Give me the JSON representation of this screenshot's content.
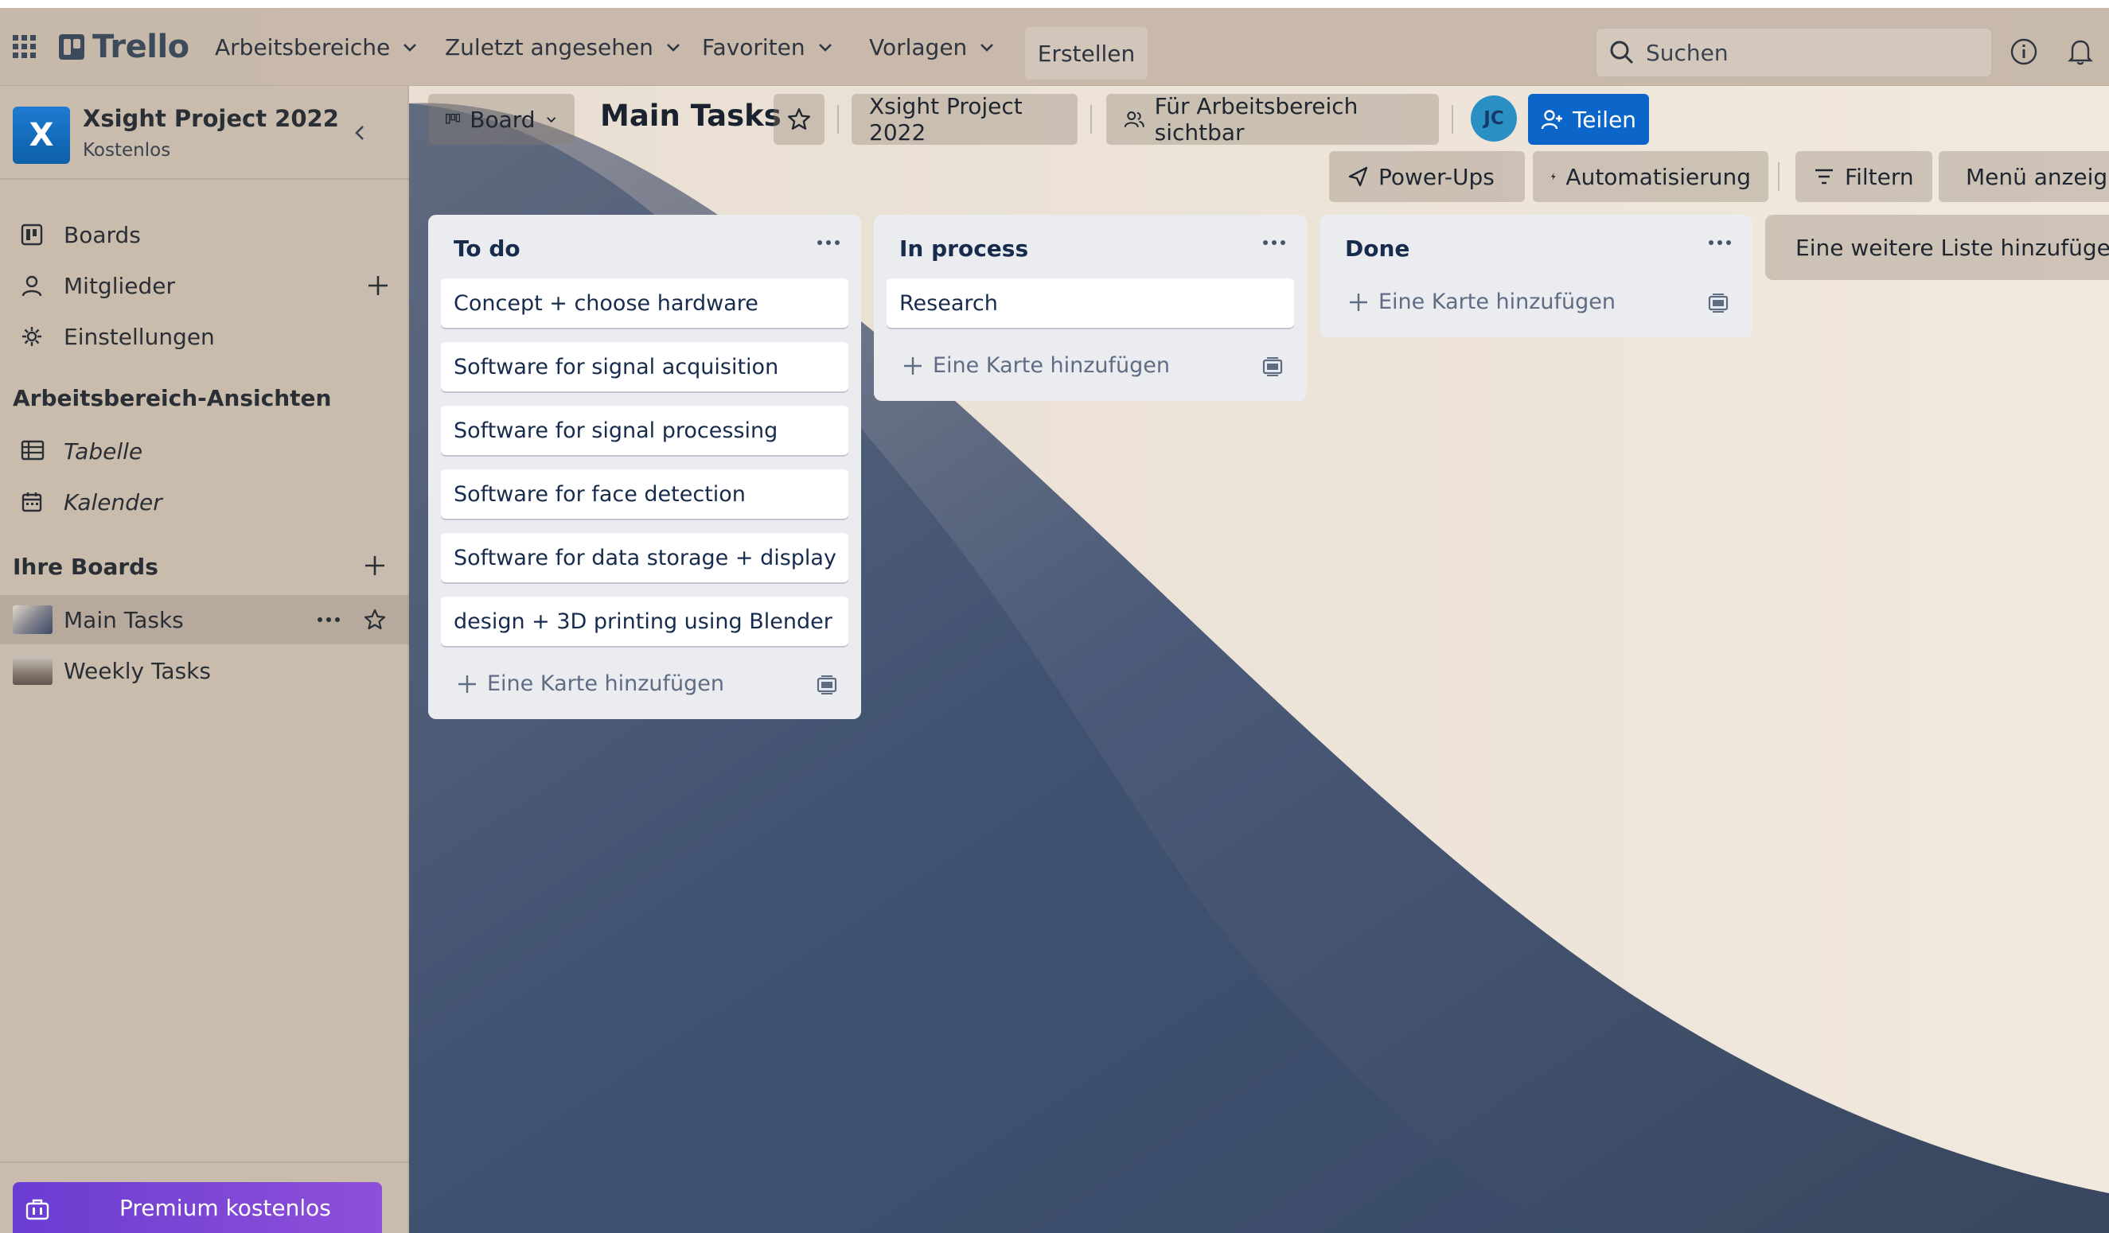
{
  "header": {
    "logo": "Trello",
    "nav": [
      "Arbeitsbereiche",
      "Zuletzt angesehen",
      "Favoriten",
      "Vorlagen"
    ],
    "create_label": "Erstellen",
    "search_placeholder": "Suchen"
  },
  "workspace": {
    "avatar_letter": "X",
    "name": "Xsight Project 2022",
    "plan": "Kostenlos"
  },
  "sidebar": {
    "items": [
      "Boards",
      "Mitglieder",
      "Einstellungen"
    ],
    "views_heading": "Arbeitsbereich-Ansichten",
    "views": [
      "Tabelle",
      "Kalender"
    ],
    "boards_heading": "Ihre Boards",
    "boards": [
      "Main Tasks",
      "Weekly Tasks"
    ],
    "premium_label": "Premium kostenlos"
  },
  "board": {
    "view_label": "Board",
    "title": "Main Tasks",
    "workspace_label": "Xsight Project 2022",
    "visibility_label": "Für Arbeitsbereich sichtbar",
    "member_initials": "JC",
    "share_label": "Teilen",
    "powerups_label": "Power-Ups",
    "automation_label": "Automatisierung",
    "filter_label": "Filtern",
    "menu_label": "Menü anzeig"
  },
  "lists": [
    {
      "title": "To do",
      "cards": [
        "Concept + choose hardware",
        "Software for signal acquisition",
        "Software for signal processing",
        "Software for face detection",
        "Software for data storage + display",
        "design + 3D printing using Blender"
      ],
      "add_card": "Eine Karte hinzufügen"
    },
    {
      "title": "In process",
      "cards": [
        "Research"
      ],
      "add_card": "Eine Karte hinzufügen"
    },
    {
      "title": "Done",
      "cards": [],
      "add_card": "Eine Karte hinzufügen"
    }
  ],
  "add_list_label": "Eine weitere Liste hinzufügen",
  "colors": {
    "share_button": "#0c66c9",
    "premium_start": "#6a3dd1",
    "premium_end": "#8e4fd9",
    "workspace_avatar": "#1e7bd2"
  }
}
